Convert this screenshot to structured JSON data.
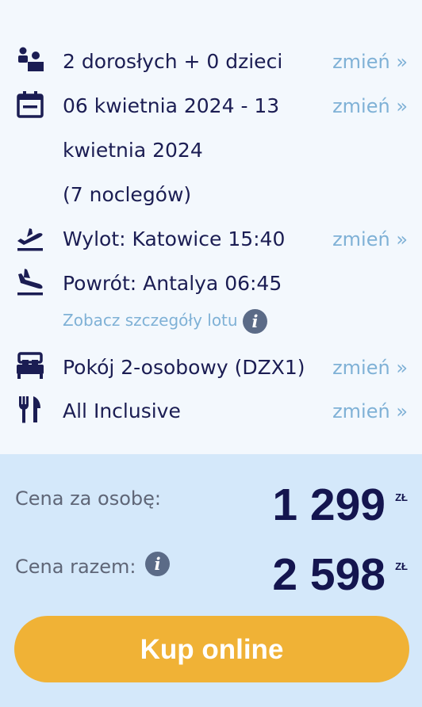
{
  "details": {
    "travelers": {
      "text": "2 dorosłych + 0 dzieci",
      "change": "zmień »",
      "icon": "people-icon"
    },
    "dates": {
      "line1": "06 kwietnia 2024 - 13",
      "line2": "kwietnia 2024",
      "line3": "(7 noclegów)",
      "change": "zmień »",
      "icon": "calendar-icon"
    },
    "departure": {
      "text": "Wylot: Katowice 15:40",
      "change": "zmień »",
      "icon": "plane-takeoff-icon"
    },
    "return": {
      "text": "Powrót: Antalya 06:45",
      "icon": "plane-landing-icon"
    },
    "flight_details_link": "Zobacz szczegóły lotu",
    "room": {
      "text": "Pokój 2-osobowy (DZX1)",
      "change": "zmień »",
      "icon": "bed-icon"
    },
    "board": {
      "text": "All Inclusive",
      "change": "zmień »",
      "icon": "cutlery-icon"
    }
  },
  "price": {
    "per_person_label": "Cena za osobę:",
    "per_person_value": "1 299",
    "total_label": "Cena razem:",
    "total_value": "2 598",
    "currency": "ZŁ"
  },
  "buy_button": "Kup online",
  "colors": {
    "accent": "#f0b236",
    "navy": "#1b1d53",
    "link": "#7fb1d6",
    "price_bg": "#d4e8fa",
    "summary_bg": "#f3f8fd"
  }
}
